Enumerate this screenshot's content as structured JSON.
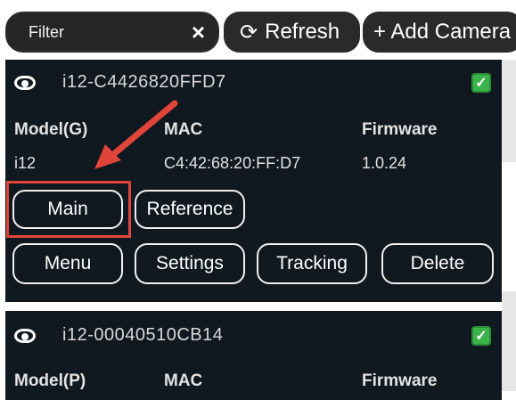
{
  "toolbar": {
    "filter_label": "Filter",
    "clear_icon": "×",
    "refresh_icon": "⟳",
    "refresh_label": "Refresh",
    "add_camera_label": "+ Add Camera"
  },
  "cameras": [
    {
      "name": "i12-C4426820FFD7",
      "checked": true,
      "model_header": "Model(G)",
      "mac_header": "MAC",
      "firmware_header": "Firmware",
      "model": "i12",
      "mac": "C4:42:68:20:FF:D7",
      "firmware": "1.0.24",
      "buttons": {
        "main": "Main",
        "reference": "Reference",
        "menu": "Menu",
        "settings": "Settings",
        "tracking": "Tracking",
        "delete": "Delete"
      }
    },
    {
      "name": "i12-00040510CB14",
      "checked": true,
      "model_header": "Model(P)",
      "mac_header": "MAC",
      "firmware_header": "Firmware"
    }
  ],
  "colors": {
    "panel_bg": "#101820",
    "accent_red": "#e0453a",
    "check_green": "#39b34a"
  }
}
